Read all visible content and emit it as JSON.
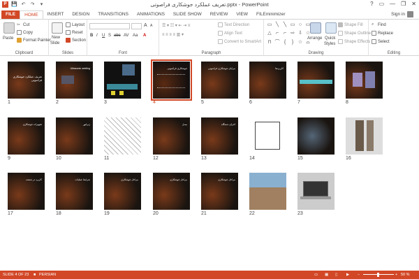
{
  "window": {
    "title": "تعریف عملکرد جوشکاری فراصوتی.pptx - PowerPoint",
    "min": "—",
    "restore": "❐",
    "close": "✕",
    "help": "?",
    "ribbon_display": "▭"
  },
  "qat": {
    "save": "💾",
    "undo": "↶",
    "redo": "↷",
    "customize": "▾"
  },
  "tabs": [
    "FILE",
    "HOME",
    "INSERT",
    "DESIGN",
    "TRANSITIONS",
    "ANIMATIONS",
    "SLIDE SHOW",
    "REVIEW",
    "VIEW",
    "FILEminimizer"
  ],
  "signin": "Sign in",
  "ribbon": {
    "clipboard": {
      "label": "Clipboard",
      "paste": "Paste",
      "cut": "Cut",
      "copy": "Copy",
      "format_painter": "Format Painter"
    },
    "slides": {
      "label": "Slides",
      "new_slide": "New",
      "new_slide2": "Slide",
      "layout": "Layout",
      "reset": "Reset",
      "section": "Section"
    },
    "font": {
      "label": "Font",
      "bold": "B",
      "italic": "I",
      "underline": "U",
      "strike": "S",
      "shadow": "abc",
      "spacing": "AV",
      "case": "Aa",
      "color": "A",
      "grow": "A",
      "shrink": "A"
    },
    "paragraph": {
      "label": "Paragraph",
      "text_direction": "Text Direction",
      "align_text": "Align Text",
      "convert_smartart": "Convert to SmartArt"
    },
    "drawing": {
      "label": "Drawing",
      "arrange": "Arrange",
      "quick_styles": "Quick",
      "quick_styles2": "Styles",
      "shape_fill": "Shape Fill",
      "shape_outline": "Shape Outline",
      "shape_effects": "Shape Effects"
    },
    "editing": {
      "label": "Editing",
      "find": "Find",
      "replace": "Replace",
      "select": "Select"
    }
  },
  "shapes": [
    "▭",
    "╲",
    "╲",
    "▭",
    "○",
    "▭",
    "△",
    "⌐",
    "⌐",
    "⇨",
    "⇩",
    "☆",
    "⊓",
    "⌒",
    "{",
    "}",
    "☆",
    "⌓"
  ],
  "slides": [
    {
      "n": "1",
      "text": "تعریف عملکرد جوشکاری فراصوتی"
    },
    {
      "n": "2",
      "text": "Ultrasonic welding"
    },
    {
      "n": "3",
      "text": ""
    },
    {
      "n": "4",
      "text": "جوشکاری فراصوتی"
    },
    {
      "n": "5",
      "text": "مزایای جوشکاری فراصوتی"
    },
    {
      "n": "6",
      "text": "کاربردها"
    },
    {
      "n": "7",
      "text": ""
    },
    {
      "n": "8",
      "text": ""
    },
    {
      "n": "9",
      "text": "تجهیزات جوشکاری"
    },
    {
      "n": "10",
      "text": "ژنراتور"
    },
    {
      "n": "11",
      "text": ""
    },
    {
      "n": "12",
      "text": "مبدل"
    },
    {
      "n": "13",
      "text": "اجزای دستگاه"
    },
    {
      "n": "14",
      "text": ""
    },
    {
      "n": "15",
      "text": ""
    },
    {
      "n": "16",
      "text": ""
    },
    {
      "n": "17",
      "text": "کاربرد در صنعت"
    },
    {
      "n": "18",
      "text": "شرایط عملیات"
    },
    {
      "n": "19",
      "text": "مراحل جوشکاری"
    },
    {
      "n": "20",
      "text": "مراحل جوشکاری"
    },
    {
      "n": "21",
      "text": "مراحل جوشکاری"
    },
    {
      "n": "22",
      "text": ""
    },
    {
      "n": "23",
      "text": ""
    }
  ],
  "status": {
    "slide_info": "SLIDE 4 OF 23",
    "language": "PERSIAN",
    "zoom": "50 %",
    "zoom_minus": "−",
    "zoom_plus": "+"
  },
  "colors": {
    "accent": "#d24726"
  }
}
